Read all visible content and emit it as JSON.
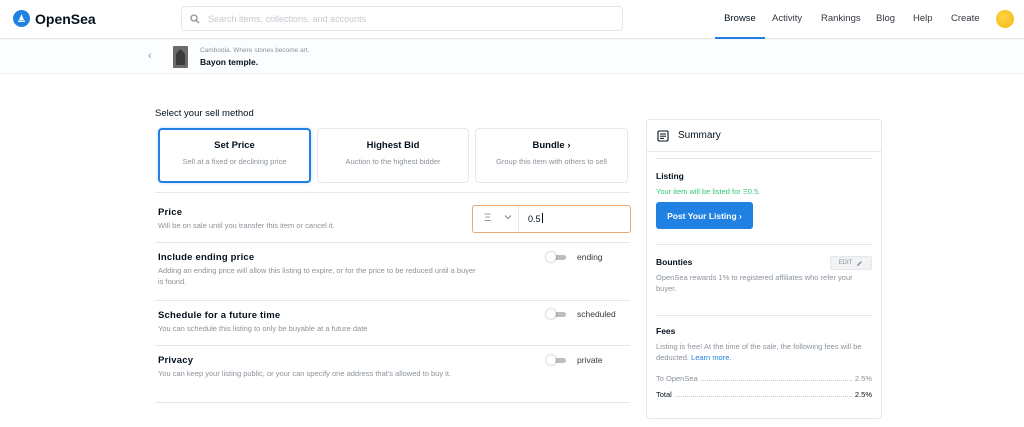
{
  "header": {
    "brand": "OpenSea",
    "search_placeholder": "Search items, collections, and accounts",
    "nav": [
      {
        "label": "Browse"
      },
      {
        "label": "Activity"
      },
      {
        "label": "Rankings"
      },
      {
        "label": "Blog"
      },
      {
        "label": "Help"
      },
      {
        "label": "Create"
      }
    ],
    "active_nav": "Browse"
  },
  "item": {
    "collection": "Cambodia. Where stones become art.",
    "name": "Bayon temple."
  },
  "sell": {
    "section_title": "Select your sell method",
    "methods": [
      {
        "title": "Set Price",
        "desc": "Sell at a fixed or declining price",
        "selected": true
      },
      {
        "title": "Highest Bid",
        "desc": "Auction to the highest bidder",
        "selected": false
      },
      {
        "title": "Bundle",
        "desc": "Group this item with others to sell",
        "selected": false
      }
    ],
    "price": {
      "title": "Price",
      "desc": "Will be on sale until you transfer this item or cancel it.",
      "currency_symbol": "Ξ",
      "value": "0.5"
    },
    "ending": {
      "title": "Include ending price",
      "desc": "Adding an ending price will allow this listing to expire, or for the price to be reduced until a buyer is found.",
      "toggle_label": "ending",
      "on": false
    },
    "schedule": {
      "title": "Schedule for a future time",
      "desc": "You can schedule this listing to only be buyable at a future date",
      "toggle_label": "scheduled",
      "on": false
    },
    "privacy": {
      "title": "Privacy",
      "desc": "You can keep your listing public, or your can specify one address that's allowed to buy it.",
      "toggle_label": "private",
      "on": false
    }
  },
  "summary": {
    "title": "Summary",
    "listing_label": "Listing",
    "listing_text_prefix": "Your item will be listed for ",
    "listing_amount": "Ξ0.5.",
    "post_button": "Post Your Listing",
    "bounties_label": "Bounties",
    "edit_label": "EDIT",
    "bounties_text": "OpenSea rewards 1% to registered affiliates who refer your buyer.",
    "fees_label": "Fees",
    "fees_text": "Listing is free! At the time of the sale, the following fees will be deducted.",
    "learn_more": "Learn more.",
    "fee_rows": [
      {
        "label": "To OpenSea",
        "value": "2.5%"
      },
      {
        "label": "Total",
        "value": "2.5%"
      }
    ]
  },
  "colors": {
    "accent": "#2081e2",
    "success": "#34c77b",
    "focus_border": "#f0a56d"
  }
}
